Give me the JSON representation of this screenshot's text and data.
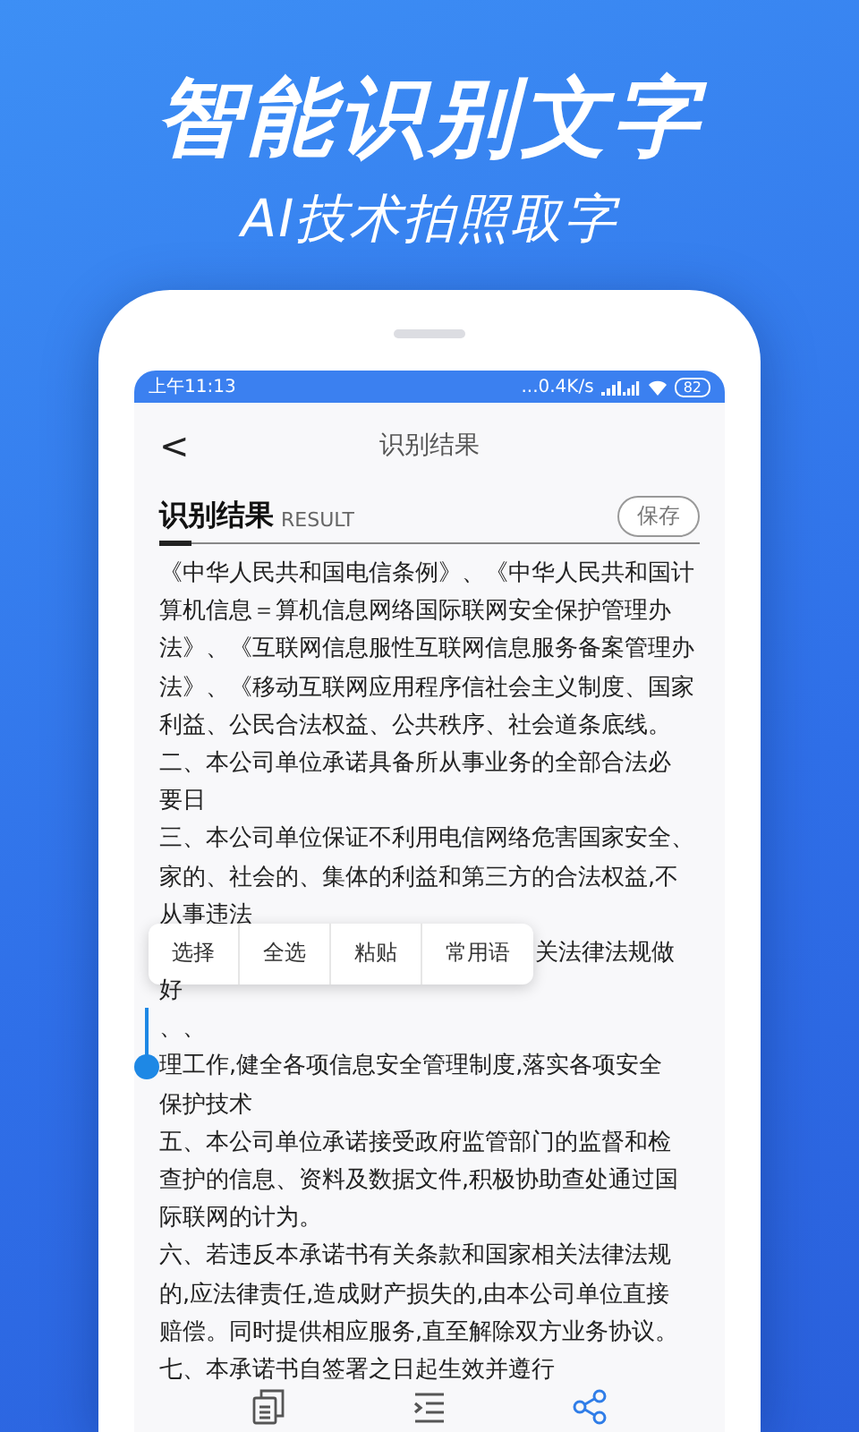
{
  "headline": {
    "title": "智能识别文字",
    "subtitle": "AI技术拍照取字"
  },
  "status_bar": {
    "time": "上午11:13",
    "speed": "...0.4K/s",
    "battery": "82"
  },
  "nav": {
    "back": "<",
    "title": "识别结果"
  },
  "result_header": {
    "title": "识别结果",
    "subtitle": "RESULT",
    "save": "保存"
  },
  "lines": [
    {
      "text": "《中华人民共和国电信条例》、《中华人民共和国计",
      "kind": "plain"
    },
    {
      "text": "算机信息＝算机信息网络国际联网安全保护管理办",
      "kind": "plain"
    },
    {
      "text": "法》、《互联网信息服性互联网信息服务备案管理办",
      "kind": "plain"
    },
    {
      "text": "法》、《移动互联网应用程序信社会主义制度、国家",
      "kind": "plain"
    },
    {
      "text": "利益、公民合法权益、公共秩序、社会道条底线。",
      "kind": "plain"
    },
    {
      "text": "二、本公司单位承诺具备所从事业务的全部合法必",
      "kind": "plain"
    },
    {
      "text": "要日",
      "kind": "plain"
    },
    {
      "text": "三、本公司单位保证不利用电信网络危害国家安全、",
      "kind": "plain"
    },
    {
      "text": "家的、社会的、集体的利益和第三方的合法权益,不",
      "kind": "plain"
    },
    {
      "text": "从事违法",
      "kind": "plain"
    },
    {
      "text": "关法律法规做",
      "kind": "menu"
    },
    {
      "text": "好",
      "kind": "plain"
    },
    {
      "text": "、、",
      "kind": "plain"
    },
    {
      "text": "理工作,健全各项信息安全管理制度,落实各项安全",
      "kind": "cursor"
    },
    {
      "text": "保护技术",
      "kind": "plain"
    },
    {
      "text": "五、本公司单位承诺接受政府监管部门的监督和检",
      "kind": "plain"
    },
    {
      "text": "查护的信息、资料及数据文件,积极协助查处通过国",
      "kind": "plain"
    },
    {
      "text": "际联网的计为。",
      "kind": "plain"
    },
    {
      "text": "六、若违反本承诺书有关条款和国家相关法律法规",
      "kind": "plain"
    },
    {
      "text": "的,应法律责任,造成财产损失的,由本公司单位直接",
      "kind": "plain"
    },
    {
      "text": "赔偿。同时提供相应服务,直至解除双方业务协议。",
      "kind": "plain"
    },
    {
      "text": "七、本承诺书自签署之日起生效并遵行",
      "kind": "plain"
    }
  ],
  "context_menu": [
    "选择",
    "全选",
    "粘贴",
    "常用语"
  ]
}
